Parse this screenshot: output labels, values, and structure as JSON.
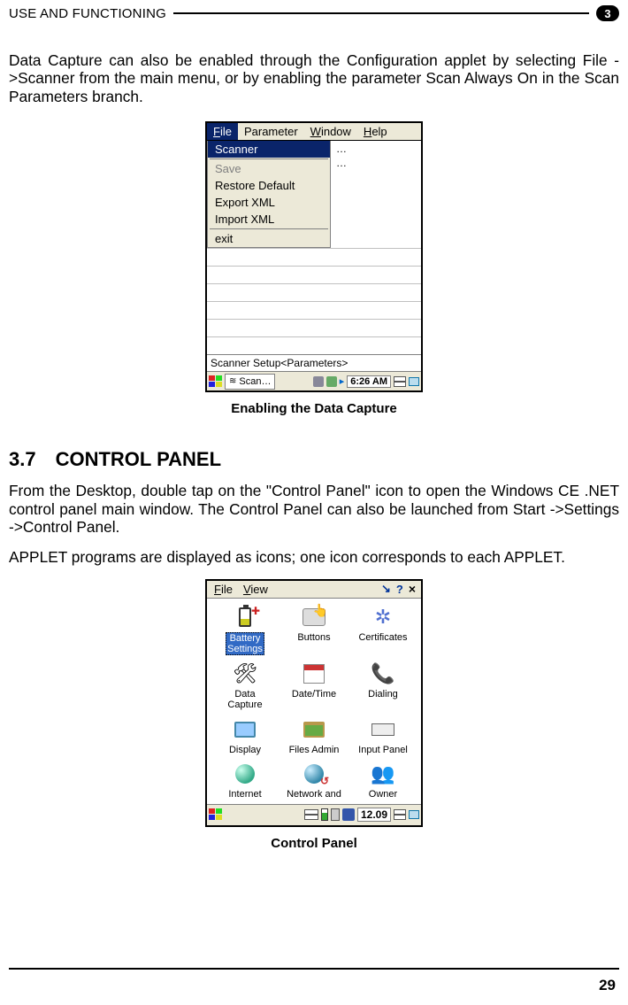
{
  "header": {
    "title": "USE AND FUNCTIONING",
    "chapter": "3"
  },
  "intro_para": "Data Capture can also be enabled through the Configuration applet by selecting File ->Scanner from the main menu, or by enabling the parameter Scan Always On in the Scan Parameters branch.",
  "fig1": {
    "menubar": {
      "file": "File",
      "parameter": "Parameter",
      "window": "Window",
      "help": "Help"
    },
    "dropdown": {
      "scanner": "Scanner",
      "save": "Save",
      "restore": "Restore Default",
      "export": "Export XML",
      "import": "Import XML",
      "exit": "exit"
    },
    "dots1": "…",
    "dots2": "…",
    "status": "Scanner Setup<Parameters>",
    "taskbtn": "Scan…",
    "clock": "6:26 AM",
    "caption": "Enabling the Data Capture"
  },
  "section": {
    "number": "3.7",
    "title": "CONTROL PANEL"
  },
  "para2": "From the Desktop, double tap on the \"Control Panel\" icon to open the Windows CE .NET control panel main window. The Control Panel can also be launched from Start ->Settings ->Control Panel.",
  "para3": "APPLET programs are displayed as icons; one icon corresponds to each APPLET.",
  "fig2": {
    "menubar": {
      "file": "File",
      "view": "View"
    },
    "items": {
      "battery": "Battery\nSettings",
      "buttons": "Buttons",
      "certificates": "Certificates",
      "datacapture": "Data\nCapture",
      "datetime": "Date/Time",
      "dialing": "Dialing",
      "display": "Display",
      "filesadmin": "Files Admin",
      "inputpanel": "Input Panel",
      "internet": "Internet",
      "network": "Network and",
      "owner": "Owner"
    },
    "clock": "12.09",
    "caption": "Control Panel"
  },
  "page_number": "29"
}
